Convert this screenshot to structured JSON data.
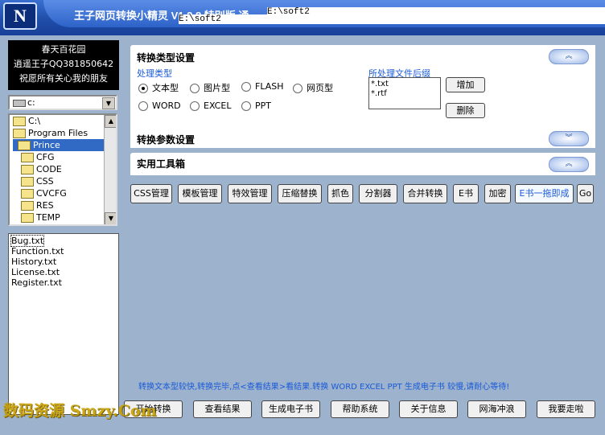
{
  "window": {
    "title": "王子网页转换小精灵 V1.2.8 特别版 通",
    "path_line1": "E:\\soft2",
    "path_line2": "E:\\soft2",
    "logo_text": "N"
  },
  "info": {
    "line1": "春天百花园",
    "line2": "逍遥王子QQ381850642",
    "line3": "祝愿所有关心我的朋友"
  },
  "drive": {
    "selected": "c:"
  },
  "tree": {
    "items": [
      "C:\\",
      "Program Files",
      "Prince",
      "CFG",
      "CODE",
      "CSS",
      "CVCFG",
      "RES",
      "TEMP"
    ],
    "selected": "Prince"
  },
  "files": [
    "Bug.txt",
    "Function.txt",
    "History.txt",
    "License.txt",
    "Register.txt"
  ],
  "sections": {
    "convert_type": {
      "title": "转换类型设置",
      "group_label": "处理类型",
      "options": [
        "文本型",
        "图片型",
        "FLASH",
        "网页型",
        "WORD",
        "EXCEL",
        "PPT"
      ],
      "selected": "文本型",
      "ext_label": "所处理文件后缀",
      "extensions": [
        "*.txt",
        "*.rtf"
      ],
      "add_label": "增加",
      "delete_label": "删除"
    },
    "params": {
      "title": "转换参数设置"
    },
    "toolbox": {
      "title": "实用工具箱"
    }
  },
  "tools": [
    "CSS管理",
    "模板管理",
    "特效管理",
    "压缩替换",
    "抓色",
    "分割器",
    "合并转换",
    "E书",
    "加密",
    "E书一拖即成",
    "Go"
  ],
  "hint": "转换文本型较快,转换完毕,点<查看结果>看结果.转换 WORD EXCEL PPT 生成电子书 较慢,请耐心等待!",
  "bottom_buttons": [
    "开始转换",
    "查看结果",
    "生成电子书",
    "帮助系统",
    "关于信息",
    "网海冲浪",
    "我要走啦"
  ],
  "watermark": "数码资源 Smzy.Com",
  "colors": {
    "title_bar": "#1f4ea8",
    "panel_bg": "#9cb2cd",
    "accent_text": "#1a5ad8"
  }
}
